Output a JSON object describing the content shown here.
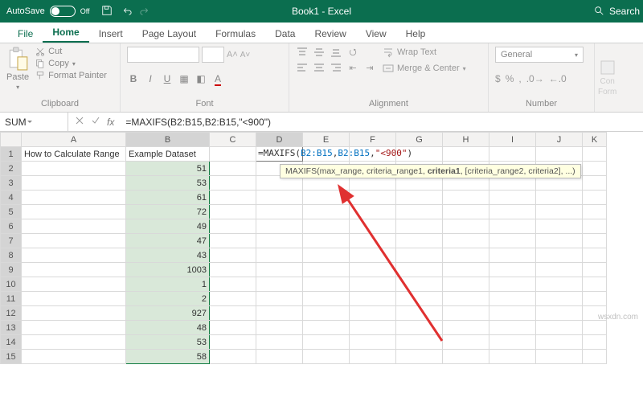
{
  "titlebar": {
    "autosave_label": "AutoSave",
    "autosave_state": "Off",
    "doc_title": "Book1 - Excel",
    "search_label": "Search"
  },
  "menu": {
    "tabs": [
      "File",
      "Home",
      "Insert",
      "Page Layout",
      "Formulas",
      "Data",
      "Review",
      "View",
      "Help"
    ],
    "active": "Home"
  },
  "ribbon": {
    "clipboard": {
      "paste": "Paste",
      "cut": "Cut",
      "copy": "Copy",
      "format_painter": "Format Painter",
      "label": "Clipboard"
    },
    "font": {
      "name": "",
      "size": "",
      "a_inc": "A▲",
      "a_dec": "A▼",
      "label": "Font"
    },
    "alignment": {
      "wrap": "Wrap Text",
      "merge": "Merge & Center",
      "label": "Alignment"
    },
    "number": {
      "format": "General",
      "label": "Number"
    },
    "cond": {
      "line1": "Con",
      "line2": "Form"
    }
  },
  "formula_bar": {
    "name_box": "SUM",
    "fx": "fx",
    "formula_text": "=MAXIFS(B2:B15,B2:B15,\"<900\")"
  },
  "grid": {
    "columns": [
      "A",
      "B",
      "C",
      "D",
      "E",
      "F",
      "G",
      "H",
      "I",
      "J",
      "K"
    ],
    "rows": [
      "1",
      "2",
      "3",
      "4",
      "5",
      "6",
      "7",
      "8",
      "9",
      "10",
      "11",
      "12",
      "13",
      "14",
      "15"
    ],
    "a1": "How to Calculate Range",
    "b1": "Example Dataset",
    "b_values": [
      "51",
      "53",
      "61",
      "72",
      "49",
      "47",
      "43",
      "1003",
      "1",
      "2",
      "927",
      "48",
      "53",
      "58"
    ],
    "d1_parts": {
      "prefix": "=MAXIFS(",
      "ref1": "B2:B15",
      "comma1": ",",
      "ref2": "B2:B15",
      "comma2": ",",
      "str": "\"<900\"",
      "suffix": ")"
    },
    "tooltip": "MAXIFS(max_range, criteria_range1, <b>criteria1</b>, [criteria_range2, criteria2], ...)"
  },
  "watermark": "wsxdn.com"
}
